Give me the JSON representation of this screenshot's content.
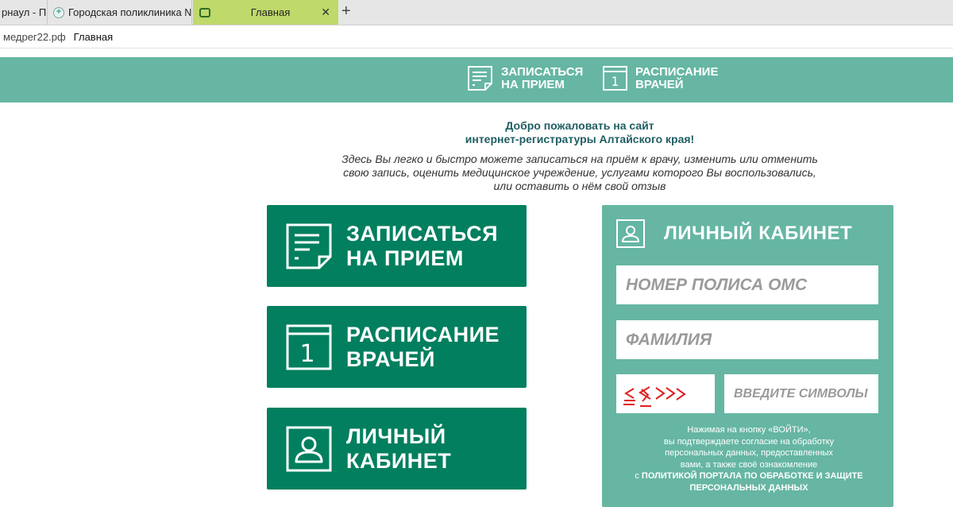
{
  "browser": {
    "tabs": [
      {
        "title": "рнаул - П"
      },
      {
        "title": "Городская поликлиника №"
      },
      {
        "title": "Главная"
      }
    ],
    "new_tab": "+",
    "close_glyph": "✕",
    "address": {
      "domain": "медрег22.рф",
      "page_title": "Главная"
    }
  },
  "header": {
    "nav": [
      {
        "line1": "ЗАПИСАТЬСЯ",
        "line2": "НА ПРИЕМ",
        "icon": "document-icon"
      },
      {
        "line1": "РАСПИСАНИЕ",
        "line2": "ВРАЧЕЙ",
        "icon": "calendar-icon"
      }
    ],
    "calendar_day": "1"
  },
  "welcome": {
    "title_line1": "Добро пожаловать на сайт",
    "title_line2": "интернет-регистратуры Алтайского края!",
    "desc_line1": "Здесь Вы легко и быстро можете записаться на приём к врачу, изменить или отменить",
    "desc_line2": "свою запись, оценить медицинское учреждение, услугами которого Вы воспользовались,",
    "desc_line3": "или оставить о нём свой отзыв"
  },
  "actions": [
    {
      "line1": "ЗАПИСАТЬСЯ",
      "line2": "НА ПРИЕМ",
      "icon": "document-icon"
    },
    {
      "line1": "РАСПИСАНИЕ",
      "line2": "ВРАЧЕЙ",
      "icon": "calendar-icon"
    },
    {
      "line1": "ЛИЧНЫЙ",
      "line2": "КАБИНЕТ",
      "icon": "user-icon"
    }
  ],
  "cabinet": {
    "title": "ЛИЧНЫЙ КАБИНЕТ",
    "polis_placeholder": "НОМЕР ПОЛИСА ОМС",
    "surname_placeholder": "ФАМИЛИЯ",
    "captcha_placeholder": "ВВЕДИТЕ СИМВОЛЫ",
    "consent_line1": "Нажимая на кнопку «ВОЙТИ»,",
    "consent_line2": "вы подтверждаете согласие на обработку",
    "consent_line3": "персональных данных, предоставленных",
    "consent_line4": "вами, а также своё ознакомление",
    "consent_prefix": "с",
    "policy_link_line1": "ПОЛИТИКОЙ ПОРТАЛА ПО ОБРАБОТКЕ И ЗАЩИТЕ",
    "policy_link_line2": "ПЕРСОНАЛЬНЫХ ДАННЫХ"
  },
  "colors": {
    "header_teal": "#66b6a3",
    "button_green": "#017f5e",
    "title_dark_teal": "#1f5e62",
    "active_tab": "#bfd96a",
    "captcha_red": "#e02020"
  }
}
